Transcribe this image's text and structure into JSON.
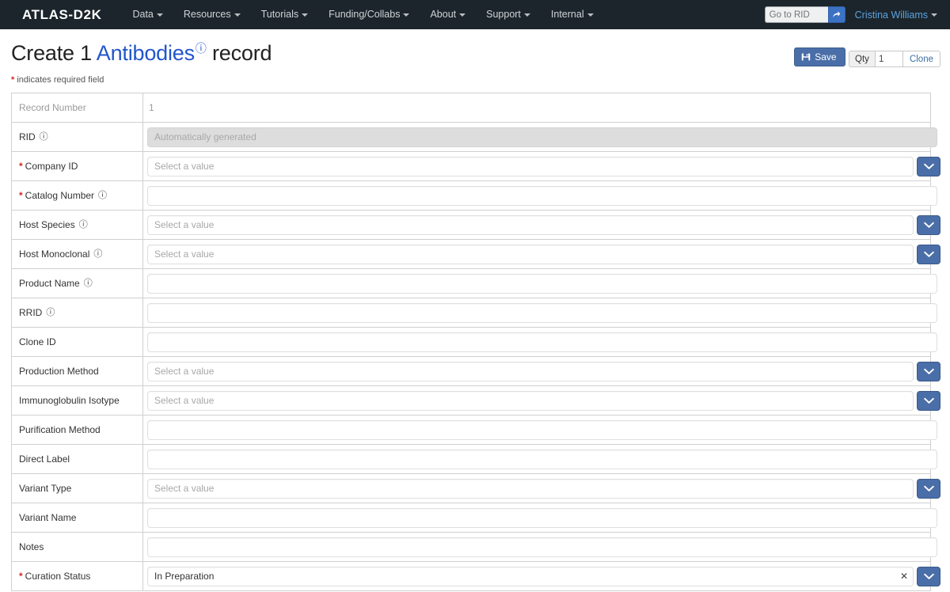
{
  "navbar": {
    "brand": "ATLAS-D2K",
    "items": [
      {
        "label": "Data",
        "icon": "chevron-down-icon"
      },
      {
        "label": "Resources",
        "icon": "chevron-down-icon"
      },
      {
        "label": "Tutorials",
        "icon": "chevron-down-icon"
      },
      {
        "label": "Funding/Collabs",
        "icon": "chevron-down-icon"
      },
      {
        "label": "About",
        "icon": "chevron-down-icon"
      },
      {
        "label": "Support",
        "icon": "chevron-down-icon"
      },
      {
        "label": "Internal",
        "icon": "chevron-down-icon"
      }
    ],
    "rid_search": {
      "placeholder": "Go to RID",
      "value": "",
      "button_icon": "go-arrow-icon"
    },
    "user": "Cristina Williams"
  },
  "header": {
    "title_prefix": "Create 1",
    "title_entity": "Antibodies",
    "title_info_icon": "ⓘ",
    "title_suffix": "record",
    "required_note_star": "*",
    "required_note": "indicates required field",
    "save_label": "Save",
    "save_icon": "save-disk-icon",
    "qty_label": "Qty",
    "qty_value": "1",
    "clone_label": "Clone"
  },
  "colors": {
    "navbar_bg": "#1c252b",
    "accent_blue": "#4a6ea8",
    "link_blue": "#2255cc",
    "required_red": "#d9241f",
    "disabled_bg": "#dddddd"
  },
  "form": {
    "select_placeholder": "Select a value",
    "rows": [
      {
        "label": "Record Number",
        "required": false,
        "info": false,
        "type": "static",
        "value": "1",
        "muted": true
      },
      {
        "label": "RID",
        "required": false,
        "info": true,
        "type": "disabled",
        "value": "Automatically generated"
      },
      {
        "label": "Company ID",
        "required": true,
        "info": false,
        "type": "select",
        "value": ""
      },
      {
        "label": "Catalog Number",
        "required": true,
        "info": true,
        "type": "text",
        "value": ""
      },
      {
        "label": "Host Species",
        "required": false,
        "info": true,
        "type": "select",
        "value": ""
      },
      {
        "label": "Host Monoclonal",
        "required": false,
        "info": true,
        "type": "select",
        "value": ""
      },
      {
        "label": "Product Name",
        "required": false,
        "info": true,
        "type": "text",
        "value": ""
      },
      {
        "label": "RRID",
        "required": false,
        "info": true,
        "type": "text",
        "value": ""
      },
      {
        "label": "Clone ID",
        "required": false,
        "info": false,
        "type": "text",
        "value": ""
      },
      {
        "label": "Production Method",
        "required": false,
        "info": false,
        "type": "select",
        "value": ""
      },
      {
        "label": "Immunoglobulin Isotype",
        "required": false,
        "info": false,
        "type": "select",
        "value": ""
      },
      {
        "label": "Purification Method",
        "required": false,
        "info": false,
        "type": "text",
        "value": ""
      },
      {
        "label": "Direct Label",
        "required": false,
        "info": false,
        "type": "text",
        "value": ""
      },
      {
        "label": "Variant Type",
        "required": false,
        "info": false,
        "type": "select",
        "value": ""
      },
      {
        "label": "Variant Name",
        "required": false,
        "info": false,
        "type": "text",
        "value": ""
      },
      {
        "label": "Notes",
        "required": false,
        "info": false,
        "type": "text",
        "value": ""
      },
      {
        "label": "Curation Status",
        "required": true,
        "info": false,
        "type": "select",
        "value": "In Preparation",
        "clearable": true
      }
    ]
  }
}
